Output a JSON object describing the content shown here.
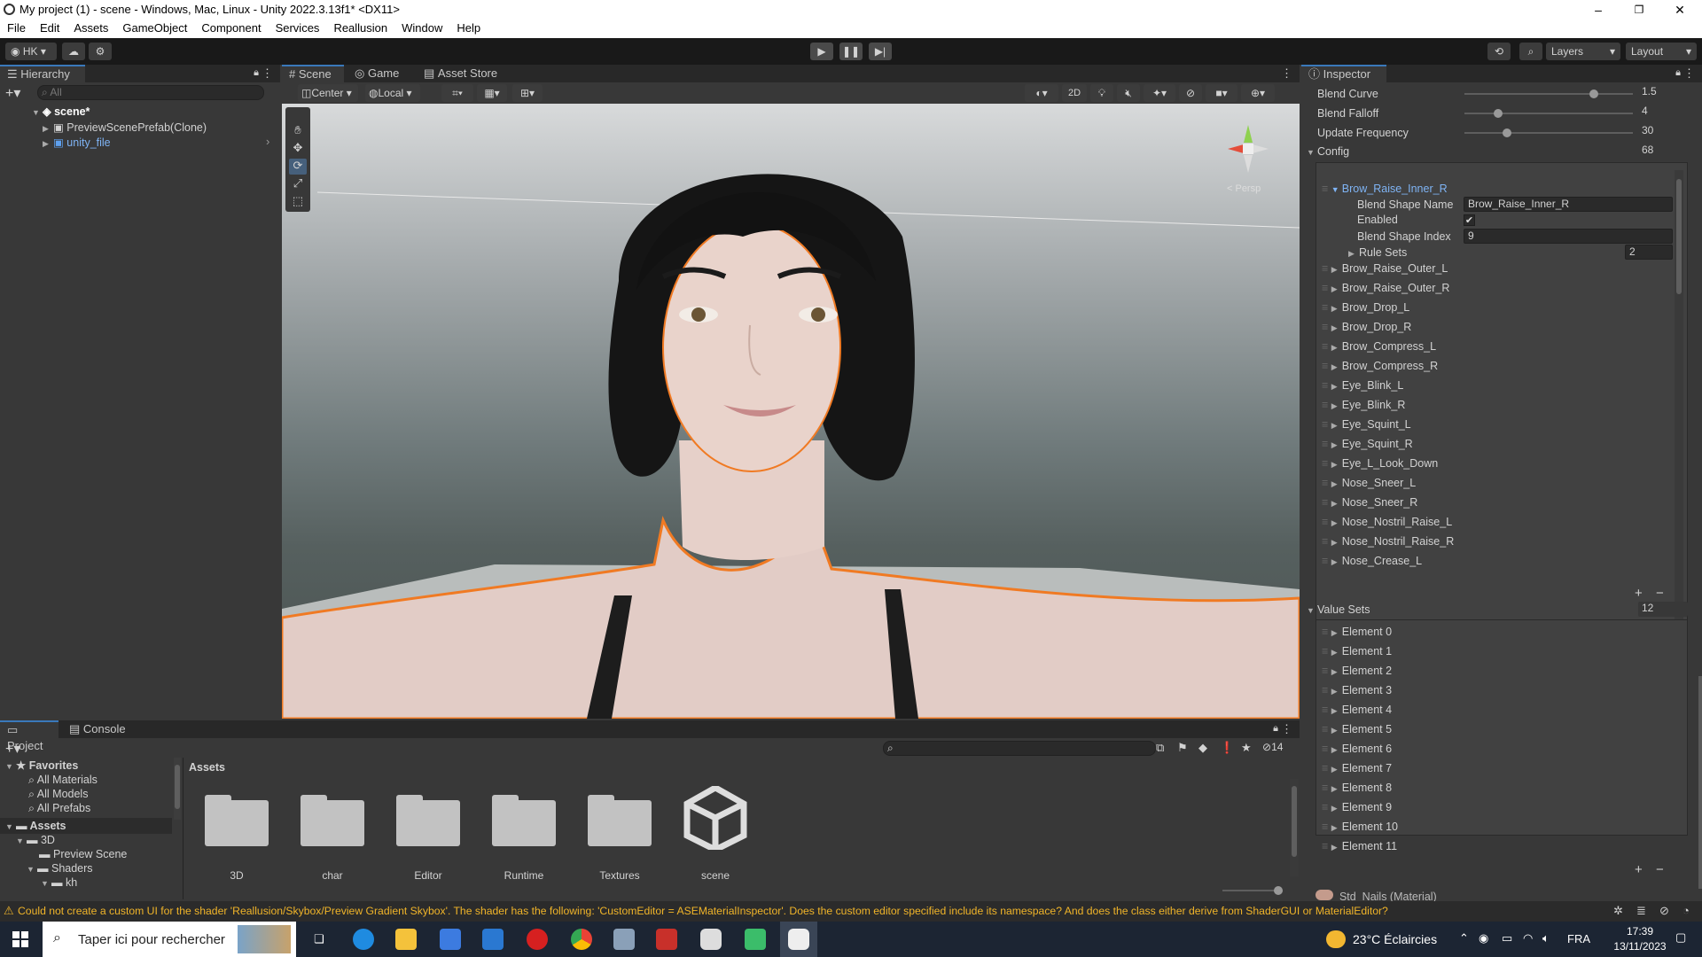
{
  "window": {
    "title": "My project (1) - scene - Windows, Mac, Linux - Unity 2022.3.13f1* <DX11>",
    "minimize": "–",
    "maximize": "❐",
    "close": "✕"
  },
  "menu": [
    "File",
    "Edit",
    "Assets",
    "GameObject",
    "Component",
    "Services",
    "Reallusion",
    "Window",
    "Help"
  ],
  "toolbar": {
    "account": "HK",
    "layers_label": "Layers",
    "layout_label": "Layout"
  },
  "hierarchy": {
    "tab": "Hierarchy",
    "search_placeholder": "All",
    "scene": "scene*",
    "items": [
      "PreviewScenePrefab(Clone)",
      "unity_file"
    ]
  },
  "scene_view": {
    "tabs": [
      "Scene",
      "Game",
      "Asset Store"
    ],
    "pivot": "Center",
    "space": "Local",
    "mode_2d": "2D",
    "persp": "< Persp"
  },
  "inspector": {
    "tab": "Inspector",
    "blend_curve_label": "Blend Curve",
    "blend_curve_value": "1.5",
    "blend_curve_fraction": 0.77,
    "blend_falloff_label": "Blend Falloff",
    "blend_falloff_value": "4",
    "blend_falloff_fraction": 0.2,
    "update_freq_label": "Update Frequency",
    "update_freq_value": "30",
    "update_freq_fraction": 0.25,
    "config_label": "Config",
    "config_count": "68",
    "selected_item": "Brow_Raise_Inner_R",
    "blend_shape_name_label": "Blend Shape Name",
    "blend_shape_name_value": "Brow_Raise_Inner_R",
    "enabled_label": "Enabled",
    "blend_shape_index_label": "Blend Shape Index",
    "blend_shape_index_value": "9",
    "rule_sets_label": "Rule Sets",
    "rule_sets_value": "2",
    "config_items": [
      "Brow_Raise_Outer_L",
      "Brow_Raise_Outer_R",
      "Brow_Drop_L",
      "Brow_Drop_R",
      "Brow_Compress_L",
      "Brow_Compress_R",
      "Eye_Blink_L",
      "Eye_Blink_R",
      "Eye_Squint_L",
      "Eye_Squint_R",
      "Eye_L_Look_Down",
      "Nose_Sneer_L",
      "Nose_Sneer_R",
      "Nose_Nostril_Raise_L",
      "Nose_Nostril_Raise_R",
      "Nose_Crease_L"
    ],
    "value_sets_label": "Value Sets",
    "value_sets_count": "12",
    "value_set_items": [
      "Element 0",
      "Element 1",
      "Element 2",
      "Element 3",
      "Element 4",
      "Element 5",
      "Element 6",
      "Element 7",
      "Element 8",
      "Element 9",
      "Element 10",
      "Element 11"
    ],
    "material_label": "Std_Nails (Material)"
  },
  "project": {
    "tabs": [
      "Project",
      "Console"
    ],
    "favorites_label": "Favorites",
    "favorites": [
      "All Materials",
      "All Models",
      "All Prefabs"
    ],
    "assets_label": "Assets",
    "tree": [
      "3D",
      "Preview Scene",
      "Shaders",
      "kh"
    ],
    "breadcrumb": "Assets",
    "hidden_count": "14",
    "assets": [
      "3D",
      "char",
      "Editor",
      "Runtime",
      "Textures",
      "scene"
    ]
  },
  "status_bar": {
    "message": "Could not create a custom UI for the shader 'Reallusion/Skybox/Preview Gradient Skybox'. The shader has the following: 'CustomEditor = ASEMaterialInspector'. Does the custom editor specified include its namespace? And does the class either derive from ShaderGUI or MaterialEditor?"
  },
  "taskbar": {
    "search_placeholder": "Taper ici pour rechercher",
    "weather": "23°C  Éclaircies",
    "lang": "FRA",
    "time": "17:39",
    "date": "13/11/2023"
  },
  "colors": {
    "accent": "#3a79bb",
    "selection_outline": "#f07a23",
    "warning": "#f0b429",
    "link_blue": "#7fb4f5"
  }
}
